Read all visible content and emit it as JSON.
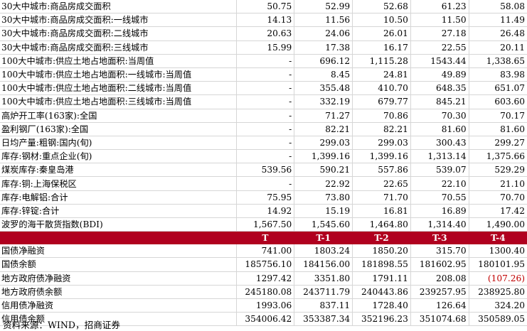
{
  "top_rows": [
    {
      "label": "30大中城市:商品房成交面积",
      "values": [
        "50.75",
        "52.99",
        "52.68",
        "61.23",
        "58.08"
      ]
    },
    {
      "label": "30大中城市:商品房成交面积:一线城市",
      "values": [
        "14.13",
        "11.56",
        "10.50",
        "11.50",
        "11.49"
      ]
    },
    {
      "label": "30大中城市:商品房成交面积:二线城市",
      "values": [
        "20.63",
        "24.06",
        "26.01",
        "27.18",
        "26.48"
      ]
    },
    {
      "label": "30大中城市:商品房成交面积:三线城市",
      "values": [
        "15.99",
        "17.38",
        "16.17",
        "22.55",
        "20.11"
      ]
    },
    {
      "label": "100大中城市:供应土地占地面积:当周值",
      "values": [
        "-",
        "696.12",
        "1,115.28",
        "1543.44",
        "1,338.65"
      ]
    },
    {
      "label": "100大中城市:供应土地占地面积:一线城市:当周值",
      "values": [
        "-",
        "8.45",
        "24.81",
        "49.89",
        "83.98"
      ]
    },
    {
      "label": "100大中城市:供应土地占地面积:二线城市:当周值",
      "values": [
        "-",
        "355.48",
        "410.70",
        "648.35",
        "651.07"
      ]
    },
    {
      "label": "100大中城市:供应土地占地面积:三线城市:当周值",
      "values": [
        "-",
        "332.19",
        "679.77",
        "845.21",
        "603.60"
      ]
    },
    {
      "label": "高炉开工率(163家):全国",
      "values": [
        "-",
        "71.27",
        "70.86",
        "70.30",
        "70.17"
      ]
    },
    {
      "label": "盈利钢厂(163家):全国",
      "values": [
        "-",
        "82.21",
        "82.21",
        "81.60",
        "81.60"
      ]
    },
    {
      "label": "日均产量:粗钢:国内(旬)",
      "values": [
        "-",
        "299.03",
        "299.03",
        "300.43",
        "299.27"
      ]
    },
    {
      "label": "库存:钢材:重点企业(旬)",
      "values": [
        "-",
        "1,399.16",
        "1,399.16",
        "1,313.14",
        "1,375.66"
      ]
    },
    {
      "label": "煤炭库存:秦皇岛港",
      "values": [
        "539.56",
        "590.21",
        "557.86",
        "539.07",
        "529.29"
      ]
    },
    {
      "label": "库存:铜:上海保税区",
      "values": [
        "-",
        "22.92",
        "22.65",
        "22.10",
        "21.10"
      ]
    },
    {
      "label": "库存:电解铝:合计",
      "values": [
        "75.95",
        "73.80",
        "71.70",
        "70.55",
        "70.70"
      ]
    },
    {
      "label": "库存:锌锭:合计",
      "values": [
        "14.92",
        "15.19",
        "16.81",
        "16.89",
        "17.42"
      ]
    },
    {
      "label": "波罗的海干散货指数(BDI)",
      "values": [
        "1,567.50",
        "1,545.60",
        "1,464.80",
        "1,314.40",
        "1,490.00"
      ]
    }
  ],
  "header": {
    "blank": "",
    "cols": [
      "T",
      "T-1",
      "T-2",
      "T-3",
      "T-4"
    ]
  },
  "bottom_rows": [
    {
      "label": "国债净融资",
      "values": [
        "741.00",
        "1803.24",
        "1850.20",
        "315.70",
        "1300.40"
      ]
    },
    {
      "label": "国债余额",
      "values": [
        "185756.10",
        "184156.00",
        "181898.55",
        "181602.95",
        "180101.95"
      ]
    },
    {
      "label": "地方政府债净融资",
      "values": [
        "1297.42",
        "3351.80",
        "1791.11",
        "208.08",
        "(107.26)"
      ]
    },
    {
      "label": "地方政府债余额",
      "values": [
        "245180.08",
        "243711.79",
        "240443.86",
        "239257.95",
        "238925.80"
      ]
    },
    {
      "label": "信用债净融资",
      "values": [
        "1993.06",
        "837.11",
        "1728.40",
        "126.64",
        "324.20"
      ]
    },
    {
      "label": "信用债余额",
      "values": [
        "354006.42",
        "353387.34",
        "352196.23",
        "351074.68",
        "350589.05"
      ]
    }
  ],
  "colors": {
    "header_bg": "#b0001f",
    "negative": "#c00000"
  },
  "source_note": "资料来源：WIND，招商证券"
}
